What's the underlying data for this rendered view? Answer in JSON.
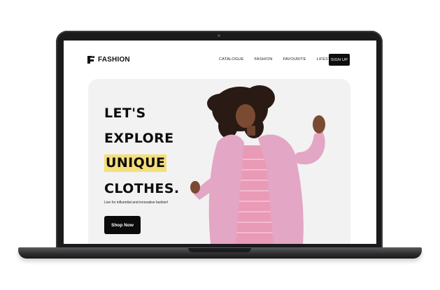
{
  "brand": {
    "name": "FASHION",
    "icon": "fashion-logo-icon"
  },
  "nav": {
    "items": [
      "CATALOGUE",
      "FASHION",
      "FAVOURITE",
      "LIFESTYLE"
    ],
    "signup_label": "SIGN UP"
  },
  "hero": {
    "headline": [
      "LET'S",
      "EXPLORE",
      "UNIQUE",
      "CLOTHES."
    ],
    "highlight_word_index": 2,
    "tagline": "Live for influential and innovative fashion!",
    "cta_label": "Shop Now",
    "image": "model-photo"
  },
  "colors": {
    "accent_highlight": "#f6de7b",
    "hero_bg": "#f1f2f1",
    "button_bg": "#0b0b0b",
    "coat": "#e3a6c4"
  }
}
